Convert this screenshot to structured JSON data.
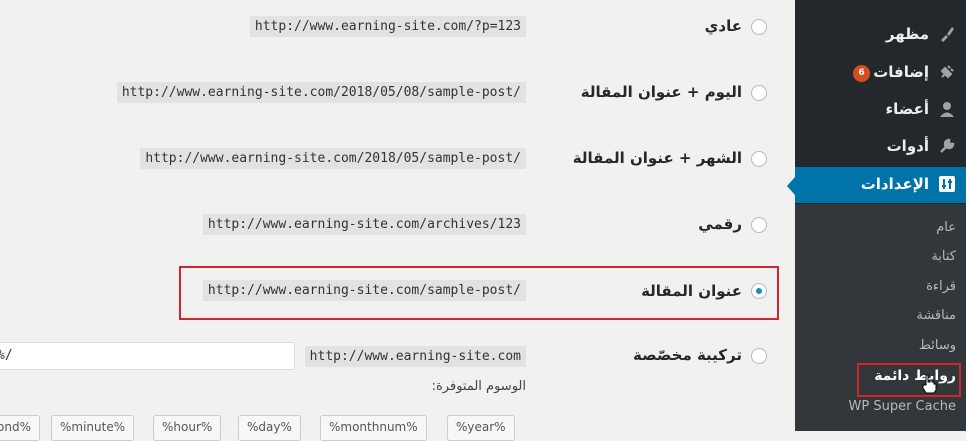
{
  "permalink_options": [
    {
      "label": "عادي",
      "example": "http://www.earning-site.com/?p=123",
      "checked": false
    },
    {
      "label": "اليوم + عنوان المقالة",
      "example": "http://www.earning-site.com/2018/05/08/sample-post/",
      "checked": false
    },
    {
      "label": "الشهر + عنوان المقالة",
      "example": "http://www.earning-site.com/2018/05/sample-post/",
      "checked": false
    },
    {
      "label": "رقمي",
      "example": "http://www.earning-site.com/archives/123",
      "checked": false
    },
    {
      "label": "عنوان المقالة",
      "example": "http://www.earning-site.com/sample-post/",
      "checked": true
    },
    {
      "label": "تركيبة مخصّصة",
      "example": "http://www.earning-site.com",
      "checked": false
    }
  ],
  "custom_structure_value": "%/",
  "available_tags_label": "الوسوم المتوفرة:",
  "tags": [
    "%year%",
    "%monthnum%",
    "%day%",
    "%hour%",
    "%minute%",
    "ond%"
  ],
  "sidebar": {
    "menu": [
      {
        "label": "مظهر",
        "icon": "paintbrush-icon"
      },
      {
        "label": "إضافات",
        "icon": "plugin-icon",
        "badge": "6"
      },
      {
        "label": "أعضاء",
        "icon": "users-icon"
      },
      {
        "label": "أدوات",
        "icon": "wrench-icon"
      },
      {
        "label": "الإعدادات",
        "icon": "settings-icon",
        "active": true
      }
    ],
    "submenu": [
      "عام",
      "كتابة",
      "قراءة",
      "مناقشة",
      "وسائط",
      "روابط دائمة",
      "WP Super Cache"
    ]
  },
  "colors": {
    "accent": "#0073aa",
    "highlight": "#d0262a",
    "sidebar_bg": "#23282d",
    "submenu_bg": "#32373c"
  }
}
